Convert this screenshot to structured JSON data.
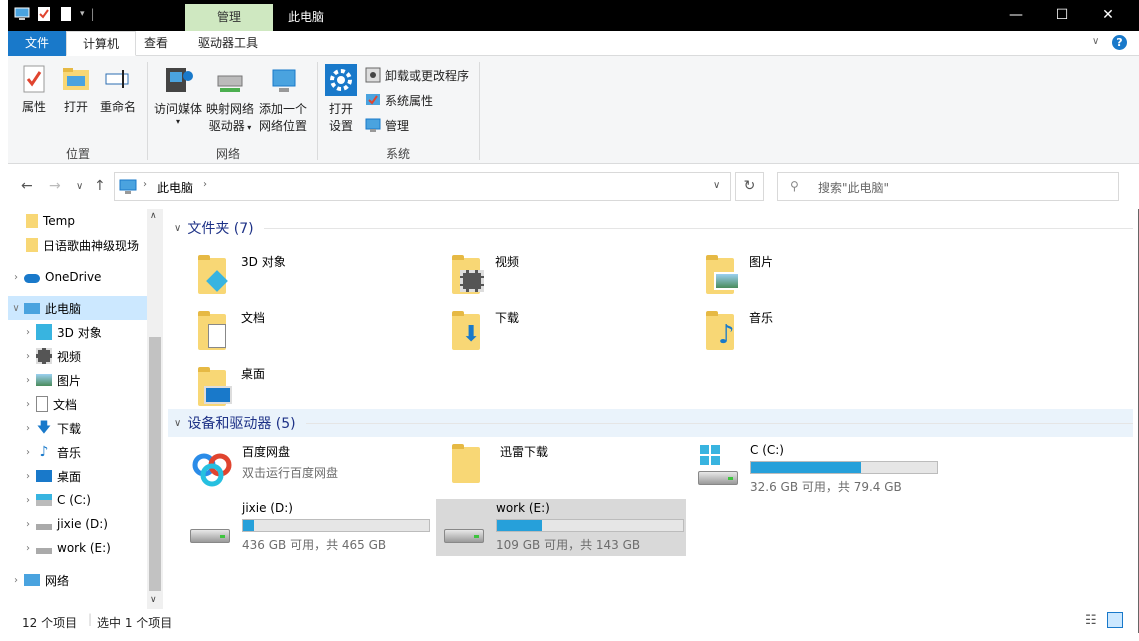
{
  "titlebar": {
    "context_tab": "管理",
    "title": "此电脑",
    "minimize": "—",
    "maximize": "☐",
    "close": "✕"
  },
  "tabs": [
    {
      "label": "文件"
    },
    {
      "label": "计算机"
    },
    {
      "label": "查看"
    },
    {
      "label": "驱动器工具"
    }
  ],
  "ribbon": {
    "location": {
      "label": "位置",
      "props": "属性",
      "open": "打开",
      "rename": "重命名"
    },
    "network": {
      "label": "网络",
      "media_1": "访问媒体",
      "map_1": "映射网络",
      "map_2": "驱动器",
      "add_1": "添加一个",
      "add_2": "网络位置"
    },
    "system": {
      "label": "系统",
      "open_1": "打开",
      "open_2": "设置",
      "uninstall": "卸载或更改程序",
      "sysprops": "系统属性",
      "manage": "管理"
    }
  },
  "address": {
    "segment": "此电脑",
    "search_placeholder": "搜索\"此电脑\""
  },
  "nav": {
    "temp": "Temp",
    "jp": "日语歌曲神级现场",
    "onedrive": "OneDrive",
    "pc": "此电脑",
    "obj3d": "3D 对象",
    "video": "视频",
    "pics": "图片",
    "docs": "文档",
    "dl": "下载",
    "music": "音乐",
    "desktop": "桌面",
    "c": "C (C:)",
    "d": "jixie (D:)",
    "e": "work (E:)",
    "network": "网络"
  },
  "folders_section": "文件夹 (7)",
  "folders": [
    "3D 对象",
    "视频",
    "图片",
    "文档",
    "下载",
    "音乐",
    "桌面"
  ],
  "drives_section": "设备和驱动器 (5)",
  "devices": {
    "baidu_name": "百度网盘",
    "baidu_sub": "双击运行百度网盘",
    "xunlei": "迅雷下载"
  },
  "drives": [
    {
      "name": "C (C:)",
      "size": "32.6 GB 可用，共 79.4 GB",
      "used": 0.59
    },
    {
      "name": "jixie (D:)",
      "size": "436 GB 可用，共 465 GB",
      "used": 0.06
    },
    {
      "name": "work (E:)",
      "size": "109 GB 可用，共 143 GB",
      "used": 0.24
    }
  ],
  "status": {
    "count": "12 个项目",
    "selected": "选中 1 个项目"
  },
  "colors": {
    "accent": "#1979ca",
    "drive_bar": "#26a0da",
    "selected": "#cce8ff"
  }
}
